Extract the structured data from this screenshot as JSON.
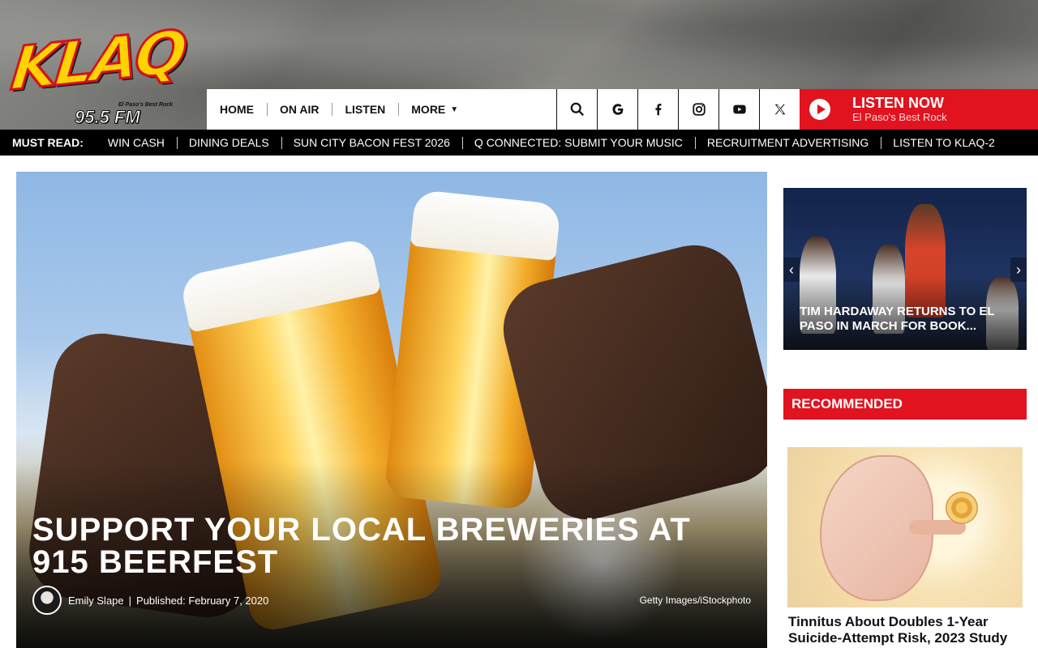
{
  "logo": {
    "name": "KLAQ",
    "tagline": "El Paso's Best Rock",
    "frequency": "95.5 FM"
  },
  "nav": {
    "items": [
      {
        "label": "HOME"
      },
      {
        "label": "ON AIR"
      },
      {
        "label": "LISTEN"
      },
      {
        "label": "MORE",
        "chevron": "chevron-down-icon"
      }
    ],
    "icons": [
      "search-icon",
      "google-icon",
      "facebook-icon",
      "instagram-icon",
      "youtube-icon",
      "x-icon"
    ]
  },
  "listen": {
    "title": "LISTEN NOW",
    "subtitle": "El Paso's Best Rock"
  },
  "must_read": {
    "label": "MUST READ:",
    "items": [
      "WIN CASH",
      "DINING DEALS",
      "SUN CITY BACON FEST 2026",
      "Q CONNECTED: SUBMIT YOUR MUSIC",
      "RECRUITMENT ADVERTISING",
      "LISTEN TO KLAQ-2"
    ]
  },
  "hero": {
    "title": "SUPPORT YOUR LOCAL BREWERIES AT 915 BEERFEST",
    "author": "Emily Slape",
    "separator": "|",
    "published": "Published: February 7, 2020",
    "credit": "Getty Images/iStockphoto"
  },
  "slider": {
    "title": "TIM HARDAWAY RETURNS TO EL PASO IN MARCH FOR BOOK..."
  },
  "recommended": {
    "heading": "RECOMMENDED",
    "title": "Tinnitus About Doubles 1-Year Suicide-Attempt Risk, 2023 Study"
  },
  "colors": {
    "accent": "#e0131f",
    "bar": "#000000",
    "logo_yellow": "#ffd200"
  }
}
